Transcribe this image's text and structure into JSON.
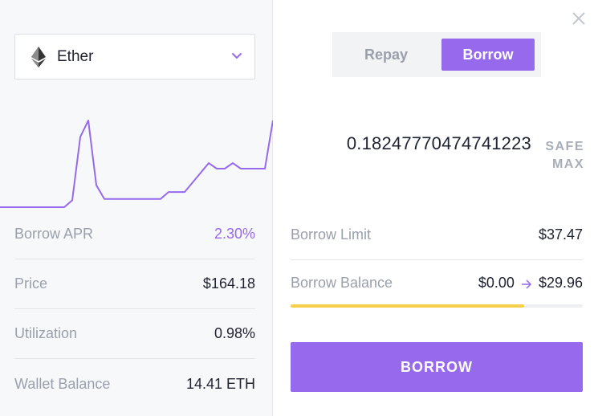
{
  "colors": {
    "accent": "#9669ed",
    "progress": "#f6d04d",
    "muted": "#9aa0ab"
  },
  "asset_select": {
    "name": "Ether",
    "icon": "ethereum-icon"
  },
  "price_history": [
    96,
    96,
    96,
    96,
    96,
    96,
    96,
    96,
    96,
    101,
    147,
    159,
    112,
    102,
    102,
    102,
    102,
    102,
    102,
    102,
    102,
    107,
    107,
    107,
    114,
    121,
    128,
    124,
    124,
    128,
    124,
    124,
    124,
    124,
    159
  ],
  "stats": [
    {
      "label": "Borrow APR",
      "value": "2.30%",
      "accent": true
    },
    {
      "label": "Price",
      "value": "$164.18",
      "accent": false
    },
    {
      "label": "Utilization",
      "value": "0.98%",
      "accent": false
    },
    {
      "label": "Wallet Balance",
      "value": "14.41 ETH",
      "accent": false
    }
  ],
  "tabs": {
    "repay": "Repay",
    "borrow": "Borrow",
    "active": "borrow"
  },
  "amount": "0.18247770474741223",
  "safe_max": {
    "line1": "SAFE",
    "line2": "MAX"
  },
  "borrow_limit": {
    "label": "Borrow Limit",
    "value": "$37.47"
  },
  "borrow_balance": {
    "label": "Borrow Balance",
    "from": "$0.00",
    "to": "$29.96"
  },
  "borrow_limit_used": 0.8,
  "submit_label": "BORROW"
}
